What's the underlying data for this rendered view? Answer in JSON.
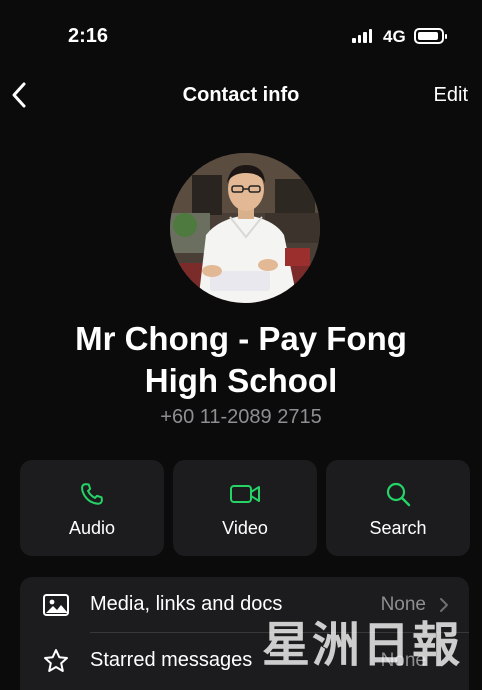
{
  "status_bar": {
    "time": "2:16",
    "network": "4G"
  },
  "nav": {
    "back_icon": "chevron-left-icon",
    "title": "Contact info",
    "edit_label": "Edit"
  },
  "contact": {
    "name_line1": "Mr Chong - Pay Fong",
    "name_line2": "High School",
    "phone": "+60 11-2089 2715"
  },
  "actions": [
    {
      "label": "Audio",
      "icon": "phone-icon"
    },
    {
      "label": "Video",
      "icon": "video-camera-icon"
    },
    {
      "label": "Search",
      "icon": "magnifier-icon"
    }
  ],
  "list": [
    {
      "label": "Media, links and docs",
      "value": "None",
      "icon": "image-icon"
    },
    {
      "label": "Starred messages",
      "value": "None",
      "icon": "star-icon"
    }
  ],
  "watermark": "星洲日報",
  "colors": {
    "accent": "#25d366",
    "background": "#0b0b0b",
    "card": "#1c1c1e",
    "secondary_text": "#8e8e93"
  }
}
